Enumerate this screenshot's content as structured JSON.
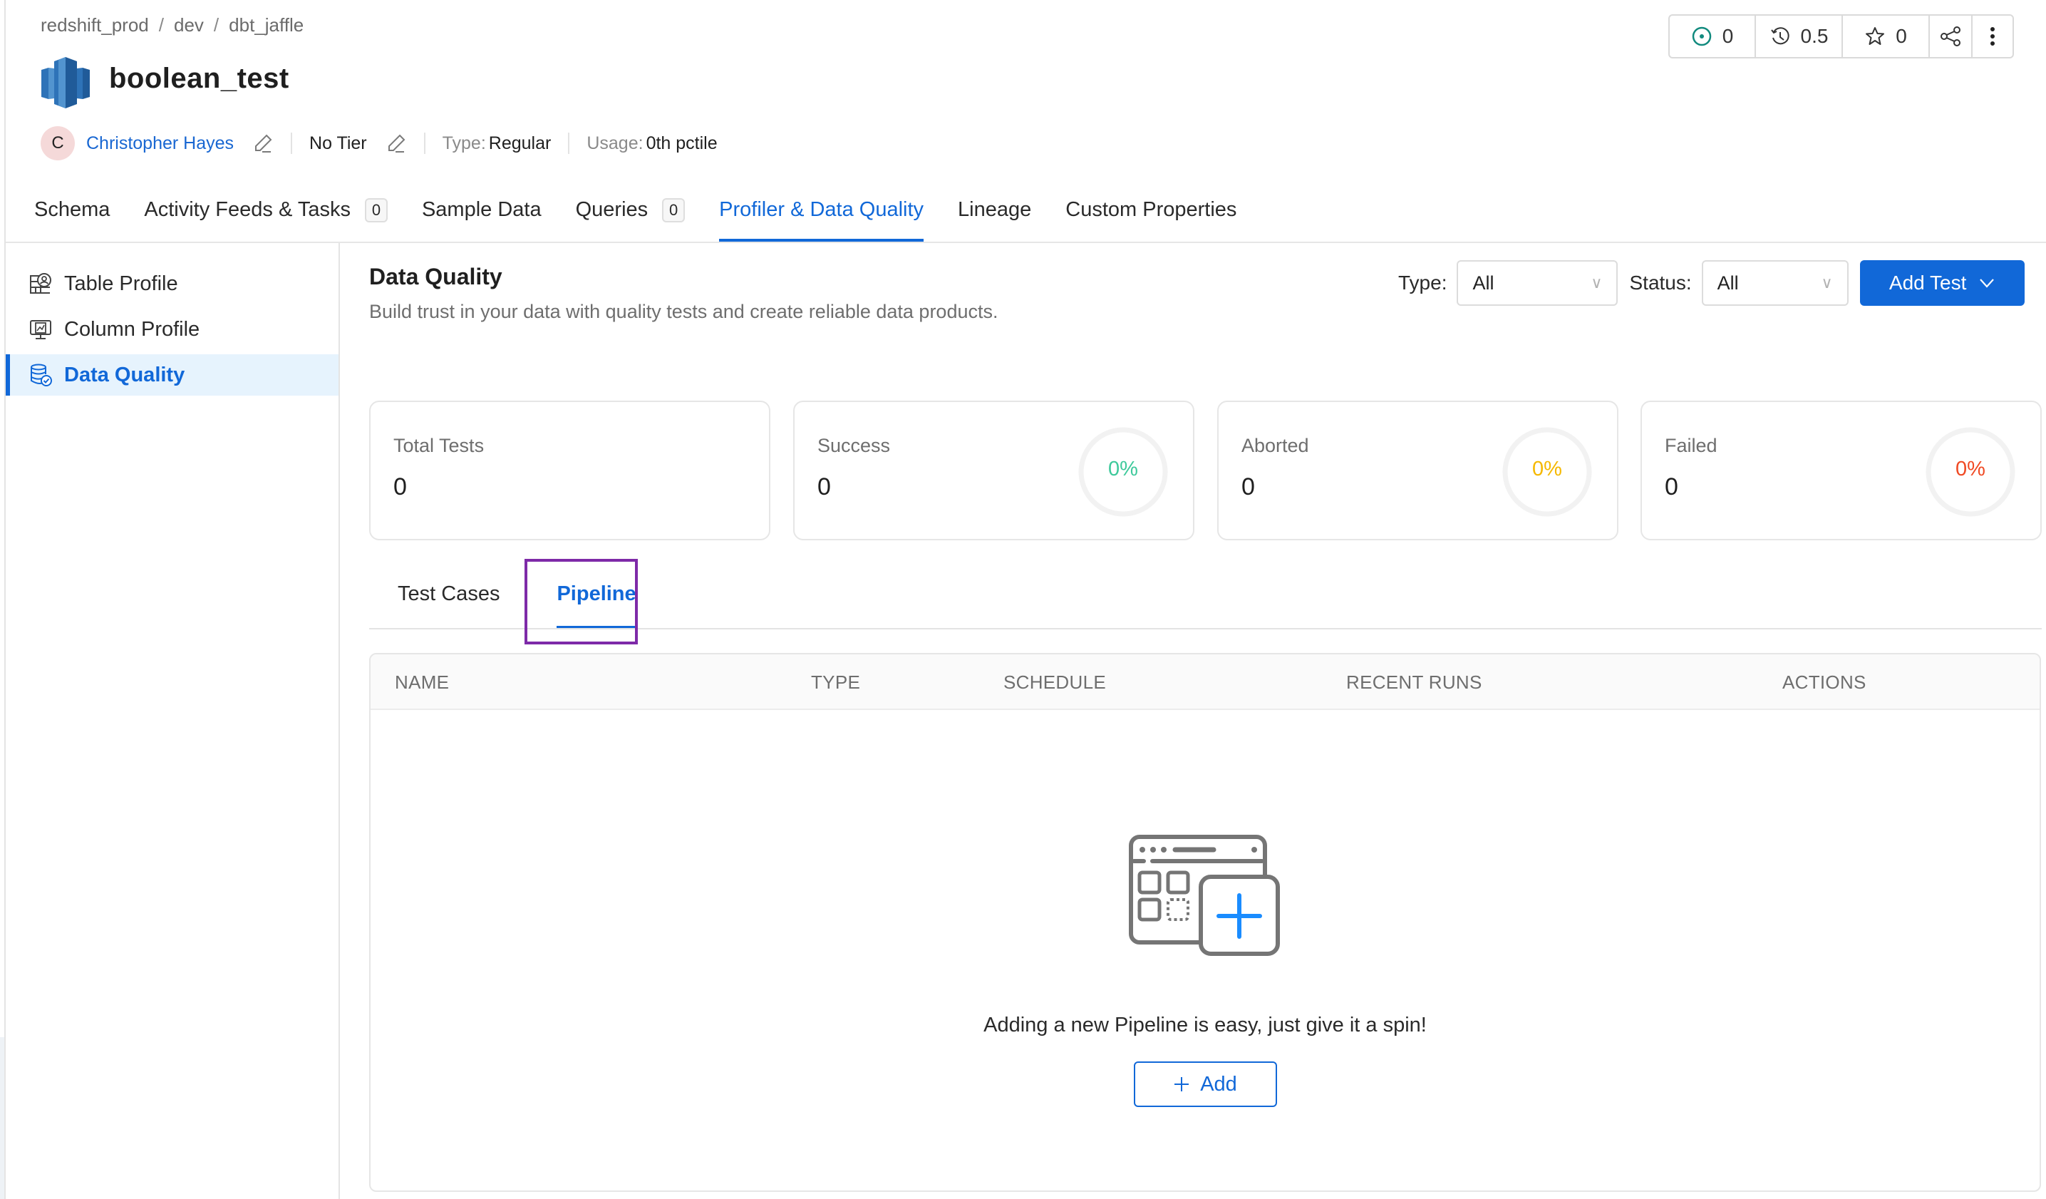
{
  "breadcrumb": [
    "redshift_prod",
    "dev",
    "dbt_jaffle"
  ],
  "entity": {
    "title": "boolean_test",
    "icon": "redshift-icon"
  },
  "meta": {
    "owner_initial": "C",
    "owner_name": "Christopher Hayes",
    "tier": "No Tier",
    "type_label": "Type:",
    "type_value": "Regular",
    "usage_label": "Usage:",
    "usage_value": "0th pctile"
  },
  "header_actions": {
    "followers": "0",
    "version": "0.5",
    "stars": "0",
    "share_icon": "share-icon",
    "more_icon": "more-vertical-icon"
  },
  "tabs": [
    {
      "label": "Schema"
    },
    {
      "label": "Activity Feeds & Tasks",
      "count": "0"
    },
    {
      "label": "Sample Data"
    },
    {
      "label": "Queries",
      "count": "0"
    },
    {
      "label": "Profiler & Data Quality",
      "active": true
    },
    {
      "label": "Lineage"
    },
    {
      "label": "Custom Properties"
    }
  ],
  "sidenav": [
    {
      "label": "Table Profile",
      "icon": "table-profile-icon"
    },
    {
      "label": "Column Profile",
      "icon": "column-profile-icon"
    },
    {
      "label": "Data Quality",
      "icon": "data-quality-icon",
      "active": true
    }
  ],
  "data_quality": {
    "title": "Data Quality",
    "description": "Build trust in your data with quality tests and create reliable data products.",
    "type_label": "Type:",
    "type_value": "All",
    "status_label": "Status:",
    "status_value": "All",
    "add_test_label": "Add Test"
  },
  "stats": [
    {
      "label": "Total Tests",
      "value": "0"
    },
    {
      "label": "Success",
      "value": "0",
      "percent": "0%",
      "color": "#3ec99b"
    },
    {
      "label": "Aborted",
      "value": "0",
      "percent": "0%",
      "color": "#f5b800"
    },
    {
      "label": "Failed",
      "value": "0",
      "percent": "0%",
      "color": "#f04a24"
    }
  ],
  "subtabs": [
    {
      "label": "Test Cases"
    },
    {
      "label": "Pipeline",
      "active": true
    }
  ],
  "pipeline_table": {
    "columns": [
      "NAME",
      "TYPE",
      "SCHEDULE",
      "RECENT RUNS",
      "ACTIONS"
    ],
    "rows": [],
    "empty_message": "Adding a new Pipeline is easy, just give it a spin!",
    "add_label": "Add"
  },
  "colors": {
    "accent": "#1168d8",
    "highlight": "#7e2aa8",
    "follow_icon": "#118a7e"
  }
}
